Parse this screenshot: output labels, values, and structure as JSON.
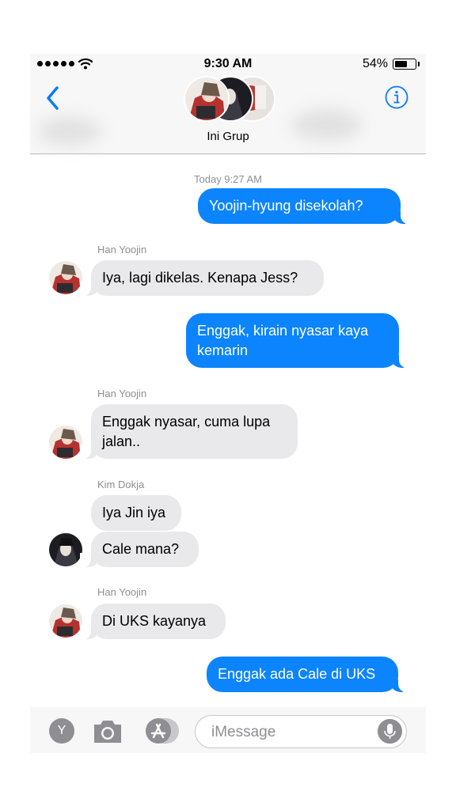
{
  "status": {
    "time": "9:30 AM",
    "battery": "54%",
    "battery_level": 0.54
  },
  "header": {
    "group_name": "Ini Grup",
    "back": "back-chevron-icon",
    "info": "info-icon"
  },
  "conversation": {
    "timestamp": "Today 9:27 AM",
    "messages": [
      {
        "direction": "outgoing",
        "text": "Yoojin-hyung disekolah?"
      },
      {
        "direction": "incoming",
        "sender": "Han Yoojin",
        "text": "Iya, lagi dikelas. Kenapa Jess?"
      },
      {
        "direction": "outgoing",
        "text": "Enggak, kirain nyasar kaya kemarin"
      },
      {
        "direction": "incoming",
        "sender": "Han Yoojin",
        "text": "Enggak nyasar, cuma lupa jalan.."
      },
      {
        "direction": "incoming",
        "sender": "Kim Dokja",
        "text": "Iya Jin iya"
      },
      {
        "direction": "incoming",
        "sender": "Kim Dokja",
        "text": "Cale mana?"
      },
      {
        "direction": "incoming",
        "sender": "Han Yoojin",
        "text": "Di UKS kayanya"
      },
      {
        "direction": "outgoing",
        "text": "Enggak ada Cale di UKS"
      }
    ]
  },
  "input": {
    "y_button": "Y",
    "placeholder": "iMessage"
  },
  "colors": {
    "outgoing": "#0b84fe",
    "incoming": "#e9e9eb",
    "accent": "#0b7aff"
  }
}
